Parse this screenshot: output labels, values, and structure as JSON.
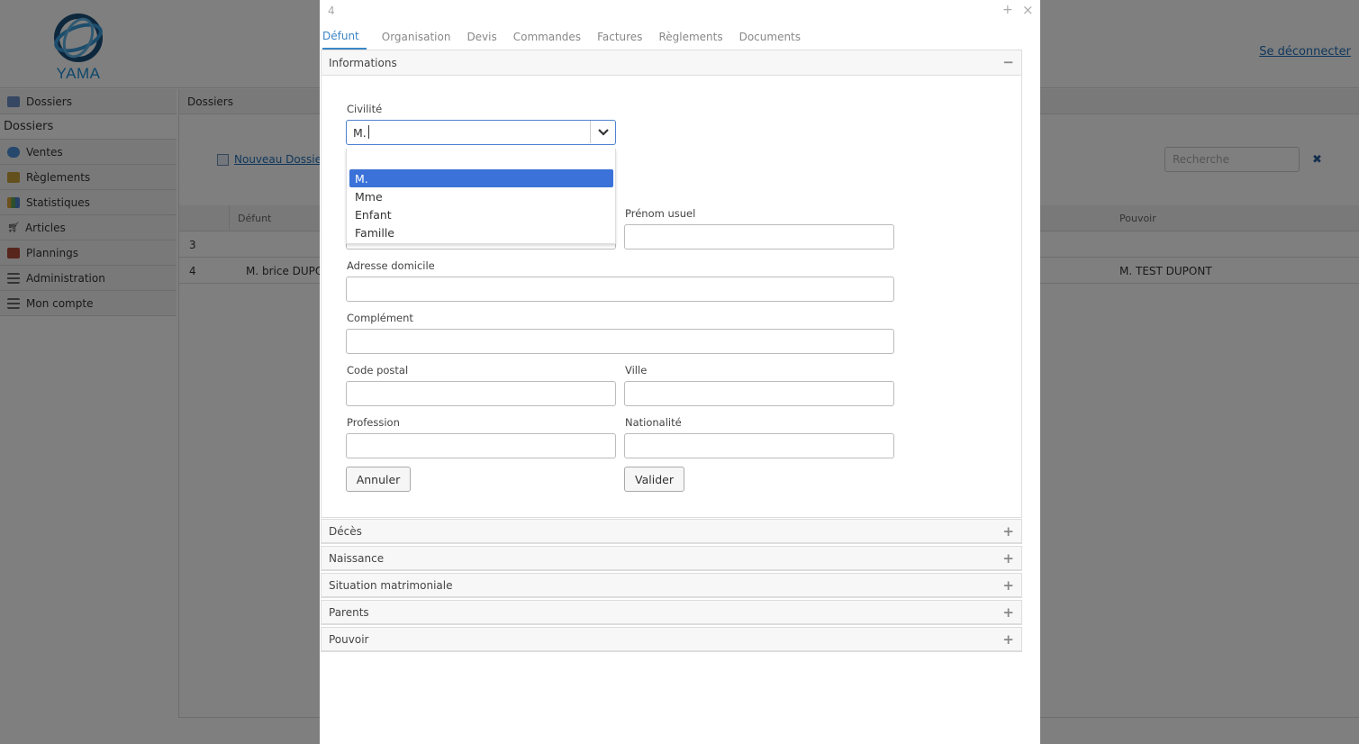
{
  "app": {
    "logo_text": "YAMA",
    "logout_label": "Se déconnecter"
  },
  "sidebar": {
    "items": [
      {
        "label": "Dossiers",
        "icon": "folder-icon"
      },
      {
        "label": "Dossiers",
        "icon": ""
      },
      {
        "label": "Ventes",
        "icon": "globe-icon"
      },
      {
        "label": "Règlements",
        "icon": "coins-icon"
      },
      {
        "label": "Statistiques",
        "icon": "bar-chart-icon"
      },
      {
        "label": "Articles",
        "icon": "cart-icon"
      },
      {
        "label": "Plannings",
        "icon": "calendar-icon"
      },
      {
        "label": "Administration",
        "icon": "list-icon"
      },
      {
        "label": "Mon compte",
        "icon": "list-icon"
      }
    ]
  },
  "main": {
    "header": "Dossiers",
    "new_folder_label": "Nouveau Dossier",
    "search_placeholder": "Recherche",
    "search_clear": "✖",
    "table": {
      "columns": [
        "",
        "Défunt",
        "Pouvoir"
      ],
      "rows": [
        {
          "id": "3",
          "defunt": "",
          "pouvoir": ""
        },
        {
          "id": "4",
          "defunt": "M. brice DUPON",
          "pouvoir": "M. TEST DUPONT"
        }
      ]
    }
  },
  "modal": {
    "title": "4",
    "expand": "+",
    "close": "×",
    "tabs": [
      "Défunt",
      "Organisation",
      "Devis",
      "Commandes",
      "Factures",
      "Règlements",
      "Documents"
    ],
    "active_tab": "Défunt",
    "sections": {
      "informations": {
        "label": "Informations",
        "toggle": "−"
      },
      "collapsed": [
        {
          "label": "Décès",
          "toggle": "+"
        },
        {
          "label": "Naissance",
          "toggle": "+"
        },
        {
          "label": "Situation matrimoniale",
          "toggle": "+"
        },
        {
          "label": "Parents",
          "toggle": "+"
        },
        {
          "label": "Pouvoir",
          "toggle": "+"
        }
      ]
    },
    "form": {
      "civilite": {
        "label": "Civilité",
        "value": "M.",
        "options": [
          "M.",
          "Mme",
          "Enfant",
          "Famille"
        ],
        "selected_option": "M."
      },
      "prenom_usuel": {
        "label": "Prénom usuel",
        "value": ""
      },
      "adresse": {
        "label": "Adresse domicile",
        "value": ""
      },
      "complement": {
        "label": "Complément",
        "value": ""
      },
      "code_postal": {
        "label": "Code postal",
        "value": ""
      },
      "ville": {
        "label": "Ville",
        "value": ""
      },
      "profession": {
        "label": "Profession",
        "value": ""
      },
      "nationalite": {
        "label": "Nationalité",
        "value": ""
      },
      "cancel_label": "Annuler",
      "submit_label": "Valider"
    }
  },
  "colors": {
    "accent": "#3b86c6",
    "select_highlight": "#3b72d9",
    "link": "#1e6fb8",
    "overlay": "rgba(0,0,0,0.5)"
  }
}
